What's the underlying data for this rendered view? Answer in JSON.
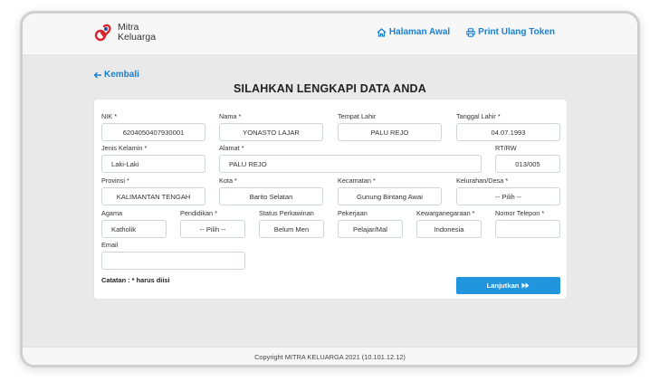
{
  "header": {
    "logo_line1": "Mitra",
    "logo_line2": "Keluarga",
    "nav_home": "Halaman Awal",
    "nav_print": "Print Ulang Token"
  },
  "back_label": "Kembali",
  "page_title": "SILAHKAN LENGKAPI DATA ANDA",
  "form": {
    "nik": {
      "label": "NIK *",
      "value": "6204050407930001"
    },
    "nama": {
      "label": "Nama *",
      "value": "YONASTO LAJAR"
    },
    "tempat_lahir": {
      "label": "Tempat Lahir",
      "value": "PALU REJO"
    },
    "tanggal_lahir": {
      "label": "Tanggal Lahir *",
      "value": "04.07.1993"
    },
    "jenis_kelamin": {
      "label": "Jenis Kelamin *",
      "value": "Laki-Laki"
    },
    "alamat": {
      "label": "Alamat *",
      "value": "PALU REJO"
    },
    "rtrw": {
      "label": "RT/RW",
      "value": "013/005"
    },
    "provinsi": {
      "label": "Provinsi *",
      "value": "KALIMANTAN TENGAH"
    },
    "kota": {
      "label": "Kota *",
      "value": "Barito Selatan"
    },
    "kecamatan": {
      "label": "Kecamatan *",
      "value": "Gunung Bintang Awai"
    },
    "kelurahan": {
      "label": "Kelurahan/Desa *",
      "value": "-- Pilih --"
    },
    "agama": {
      "label": "Agama",
      "value": "Katholik"
    },
    "pendidikan": {
      "label": "Pendidikan *",
      "value": "-- Pilih --"
    },
    "status": {
      "label": "Status Perkawinan",
      "value": "Belum Men"
    },
    "pekerjaan": {
      "label": "Pekerjaan",
      "value": "Pelajar/Mal"
    },
    "kewarganegaraan": {
      "label": "Kewarganegaraan *",
      "value": "Indonesia"
    },
    "telepon": {
      "label": "Nomor Telepon *",
      "value": ""
    },
    "email": {
      "label": "Email",
      "value": ""
    }
  },
  "note": "Catatan : * harus diisi",
  "submit_label": "Lanjutkan",
  "footer_text": "Copyright MITRA KELUARGA 2021 (10.101.12.12)",
  "colors": {
    "accent": "#2196df",
    "link": "#1b7fd0"
  }
}
